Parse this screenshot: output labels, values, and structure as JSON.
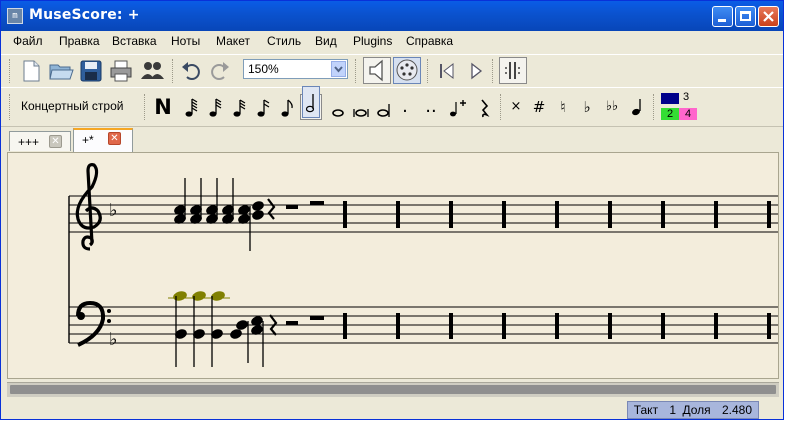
{
  "window": {
    "title": "MuseScore: +",
    "app_icon_text": "m"
  },
  "menu": [
    "Файл",
    "Правка",
    "Вставка",
    "Ноты",
    "Макет",
    "Стиль",
    "Вид",
    "Plugins",
    "Справка"
  ],
  "toolbar": {
    "zoom_value": "150%"
  },
  "toolbar2": {
    "concert_pitch_label": "Концертный строй"
  },
  "note_palette": {
    "n_label": "N",
    "dots": [
      ".",
      ".."
    ],
    "accidentals": [
      "×",
      "#",
      "♮",
      "♭",
      "♭♭"
    ],
    "voices": [
      "3",
      "2",
      "4"
    ],
    "colors": {
      "voice1": "#00008b",
      "voice2": "#33dd33",
      "voice3": "#ff66cc"
    }
  },
  "tabs": [
    {
      "label": "+++",
      "active": false
    },
    {
      "label": "+*",
      "active": true
    }
  ],
  "status": {
    "measure_label": "Такт",
    "measure": "1",
    "beat_label": "Доля",
    "beat": "2.480"
  },
  "colors": {
    "titlebar": "#0b53d0",
    "score_bg": "#f3eddc",
    "selected_note": "#808000"
  }
}
